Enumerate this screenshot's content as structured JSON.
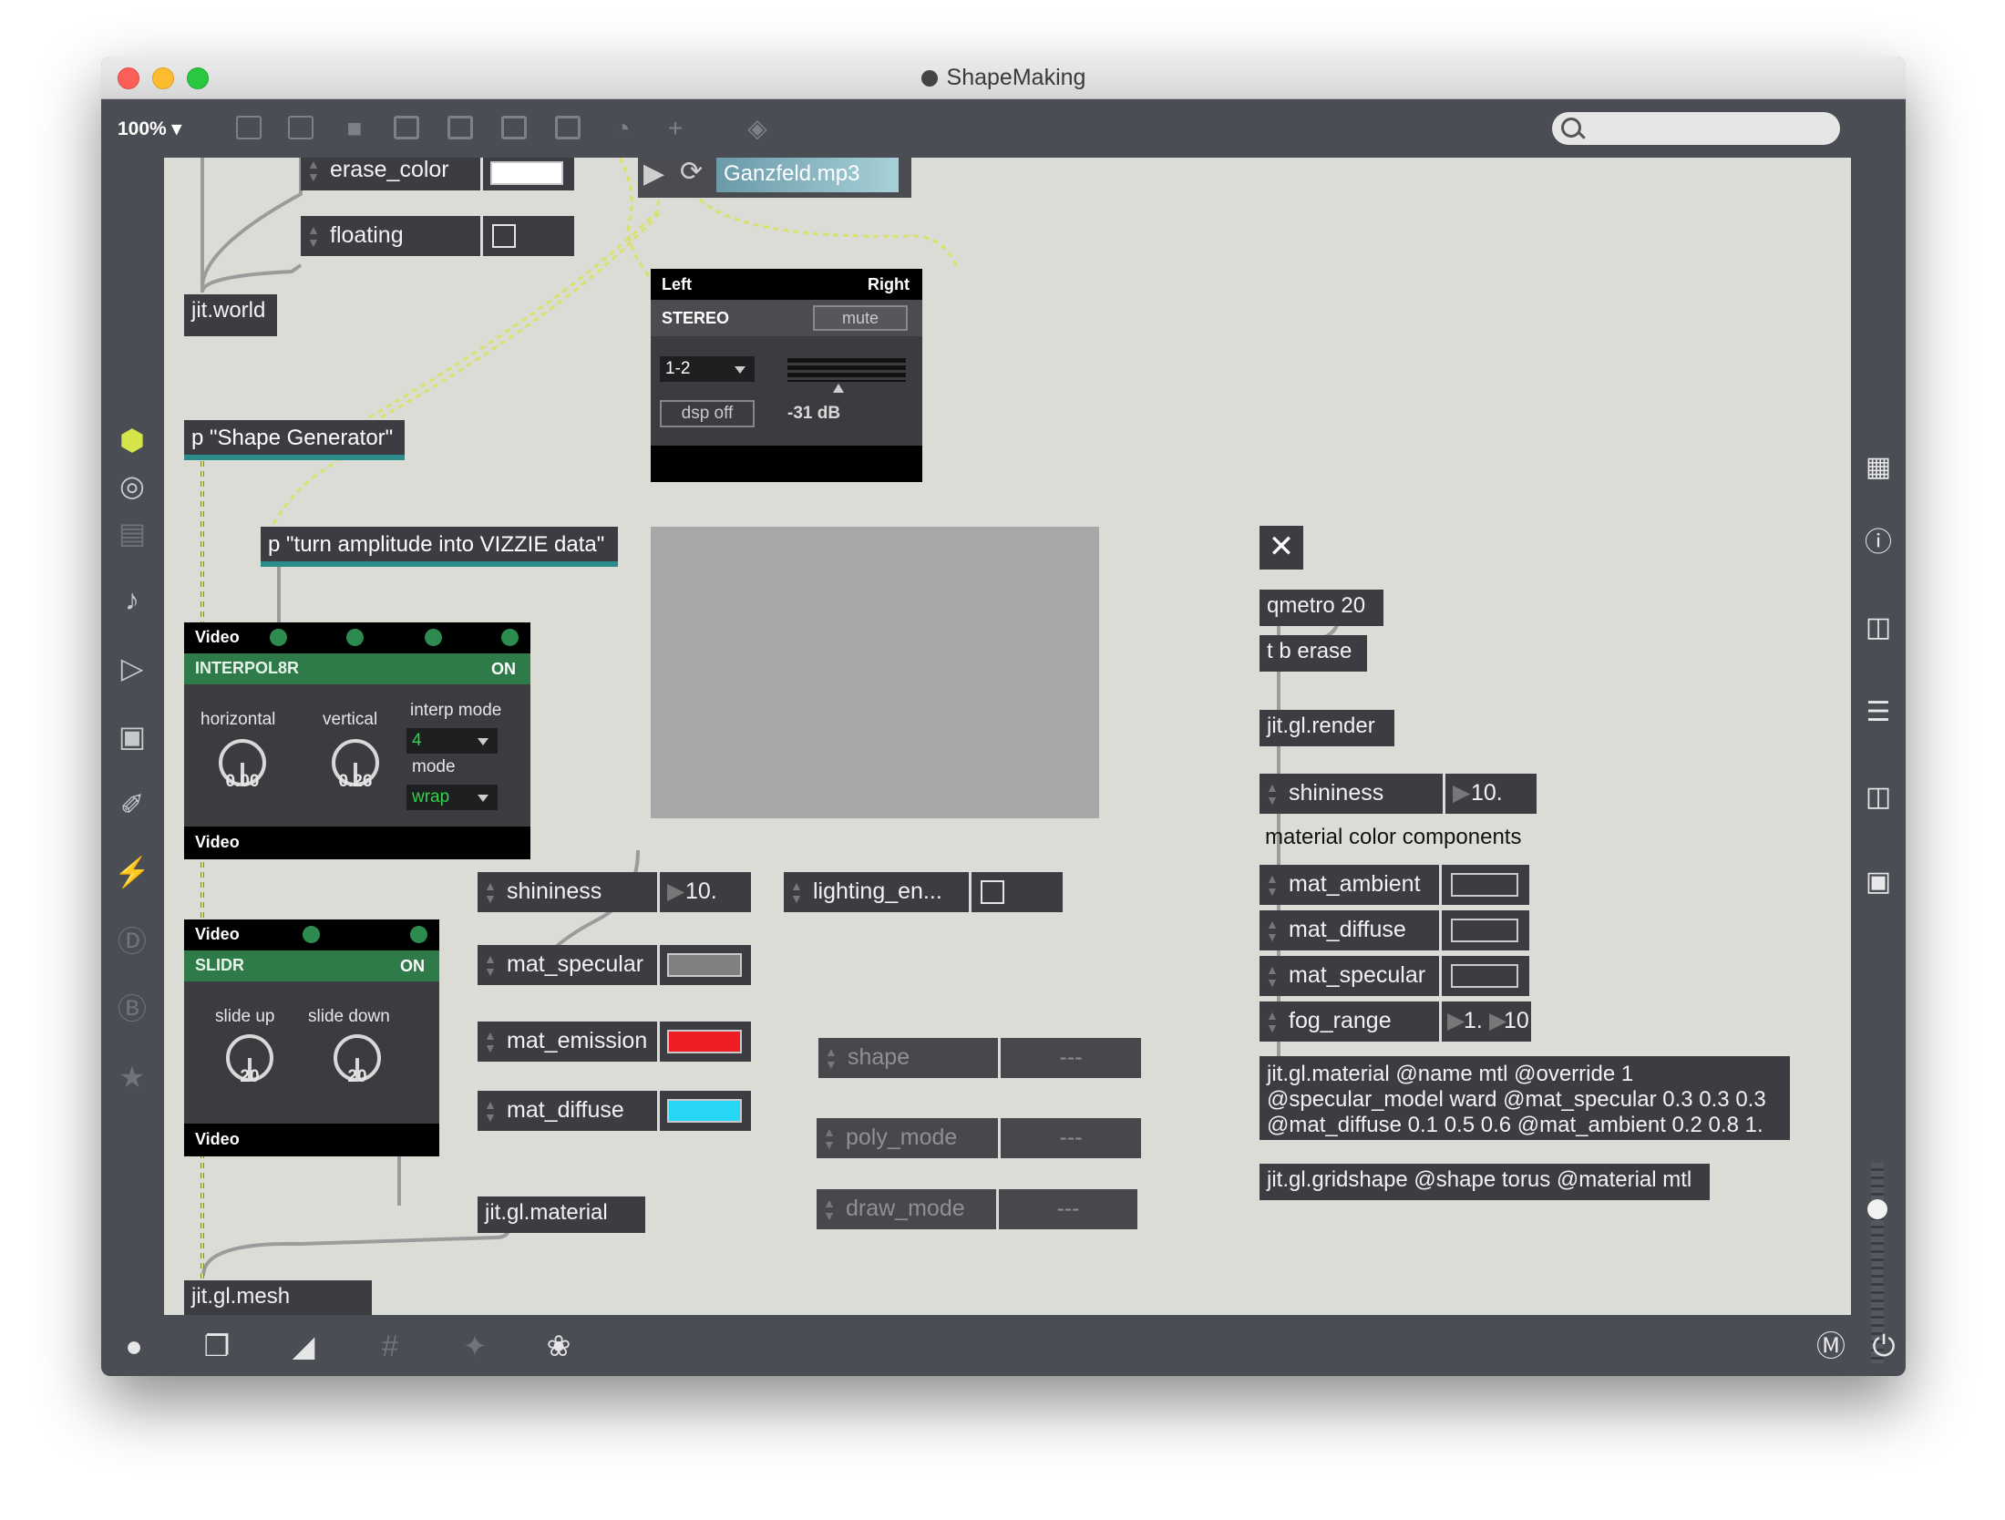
{
  "window": {
    "title": "ShapeMaking",
    "zoom": "100% ▾"
  },
  "toolbar": {
    "icons": [
      "new-object-icon",
      "message-icon",
      "comment-icon",
      "button-icon",
      "toggle-icon",
      "number-icon",
      "slider-icon",
      "dial-icon",
      "add-icon",
      "paint-icon"
    ],
    "search_placeholder": ""
  },
  "sidebar_left": {
    "icons": [
      "cube-icon",
      "target-icon",
      "film-icon",
      "music-note-icon",
      "playback-icon",
      "image-icon",
      "paperclip-icon",
      "plug-icon",
      "v-badge-icon",
      "b-badge-icon",
      "star-icon"
    ]
  },
  "sidebar_right": {
    "icons": [
      "keyboard-grid-icon",
      "info-icon",
      "columns-icon",
      "list-icon",
      "book-icon",
      "camera-icon",
      "volume-slider-icon"
    ]
  },
  "bottombar": {
    "icons": [
      "lock-icon",
      "windows-icon",
      "presentation-icon",
      "grid-icon",
      "snap-icon",
      "wrench-icon",
      "m-icon",
      "power-icon"
    ]
  },
  "patch": {
    "erase_color": {
      "label": "erase_color"
    },
    "floating": {
      "label": "floating"
    },
    "jit_world": "jit.world",
    "player": {
      "file": "Ganzfeld.mp3"
    },
    "audio_out": {
      "left": "Left",
      "right": "Right",
      "name": "STEREO",
      "mute": "mute",
      "channels": "1-2",
      "dsp": "dsp off",
      "level": "-31 dB"
    },
    "shape_generator": "p \"Shape Generator\"",
    "amp_to_vizzie": "p \"turn amplitude into VIZZIE data\"",
    "interpol8r": {
      "header": "Video",
      "name": "INTERPOL8R",
      "state": "ON",
      "horizontal_label": "horizontal",
      "vertical_label": "vertical",
      "horizontal": "0.00",
      "vertical": "0.26",
      "interp_label": "interp mode",
      "interp_value": "4",
      "mode_label": "mode",
      "mode_value": "wrap",
      "footer": "Video"
    },
    "slidr": {
      "header": "Video",
      "name": "SLIDR",
      "state": "ON",
      "up_label": "slide up",
      "down_label": "slide down",
      "up": "20",
      "down": "20",
      "footer": "Video"
    },
    "mat_left": {
      "shininess": {
        "label": "shininess",
        "value": "10."
      },
      "specular": {
        "label": "mat_specular",
        "color": "#808080"
      },
      "emission": {
        "label": "mat_emission",
        "color": "#ee1c24"
      },
      "diffuse": {
        "label": "mat_diffuse",
        "color": "#27d6f4"
      }
    },
    "lighting": {
      "label": "lighting_en..."
    },
    "jit_gl_material_left": "jit.gl.material",
    "jit_gl_mesh": "jit.gl.mesh",
    "shape": {
      "label": "shape",
      "value": "---"
    },
    "poly_mode": {
      "label": "poly_mode",
      "value": "---"
    },
    "draw_mode": {
      "label": "draw_mode",
      "value": "---"
    },
    "qmetro": "qmetro 20",
    "tb_erase": "t b erase",
    "jit_gl_render": "jit.gl.render",
    "mat_right": {
      "shininess": {
        "label": "shininess",
        "value": "10."
      },
      "comment": "material color components",
      "ambient": {
        "label": "mat_ambient"
      },
      "diffuse": {
        "label": "mat_diffuse"
      },
      "specular": {
        "label": "mat_specular"
      },
      "fog": {
        "label": "fog_range",
        "v1": "1.",
        "v2": "10"
      }
    },
    "jit_gl_material_right": {
      "line1": "jit.gl.material @name mtl @override 1",
      "line2": "@specular_model ward @mat_specular 0.3 0.3 0.3",
      "line3": "@mat_diffuse 0.1 0.5 0.6 @mat_ambient 0.2 0.8 1."
    },
    "gridshape": "jit.gl.gridshape @shape torus @material mtl"
  },
  "colors": {
    "canvas": "#dcdcd7",
    "object": "#3b3d42",
    "vizzie_green": "#2e7a48",
    "patchcord_signal": "#d8e26a",
    "patchcord": "#9b9b9b"
  }
}
